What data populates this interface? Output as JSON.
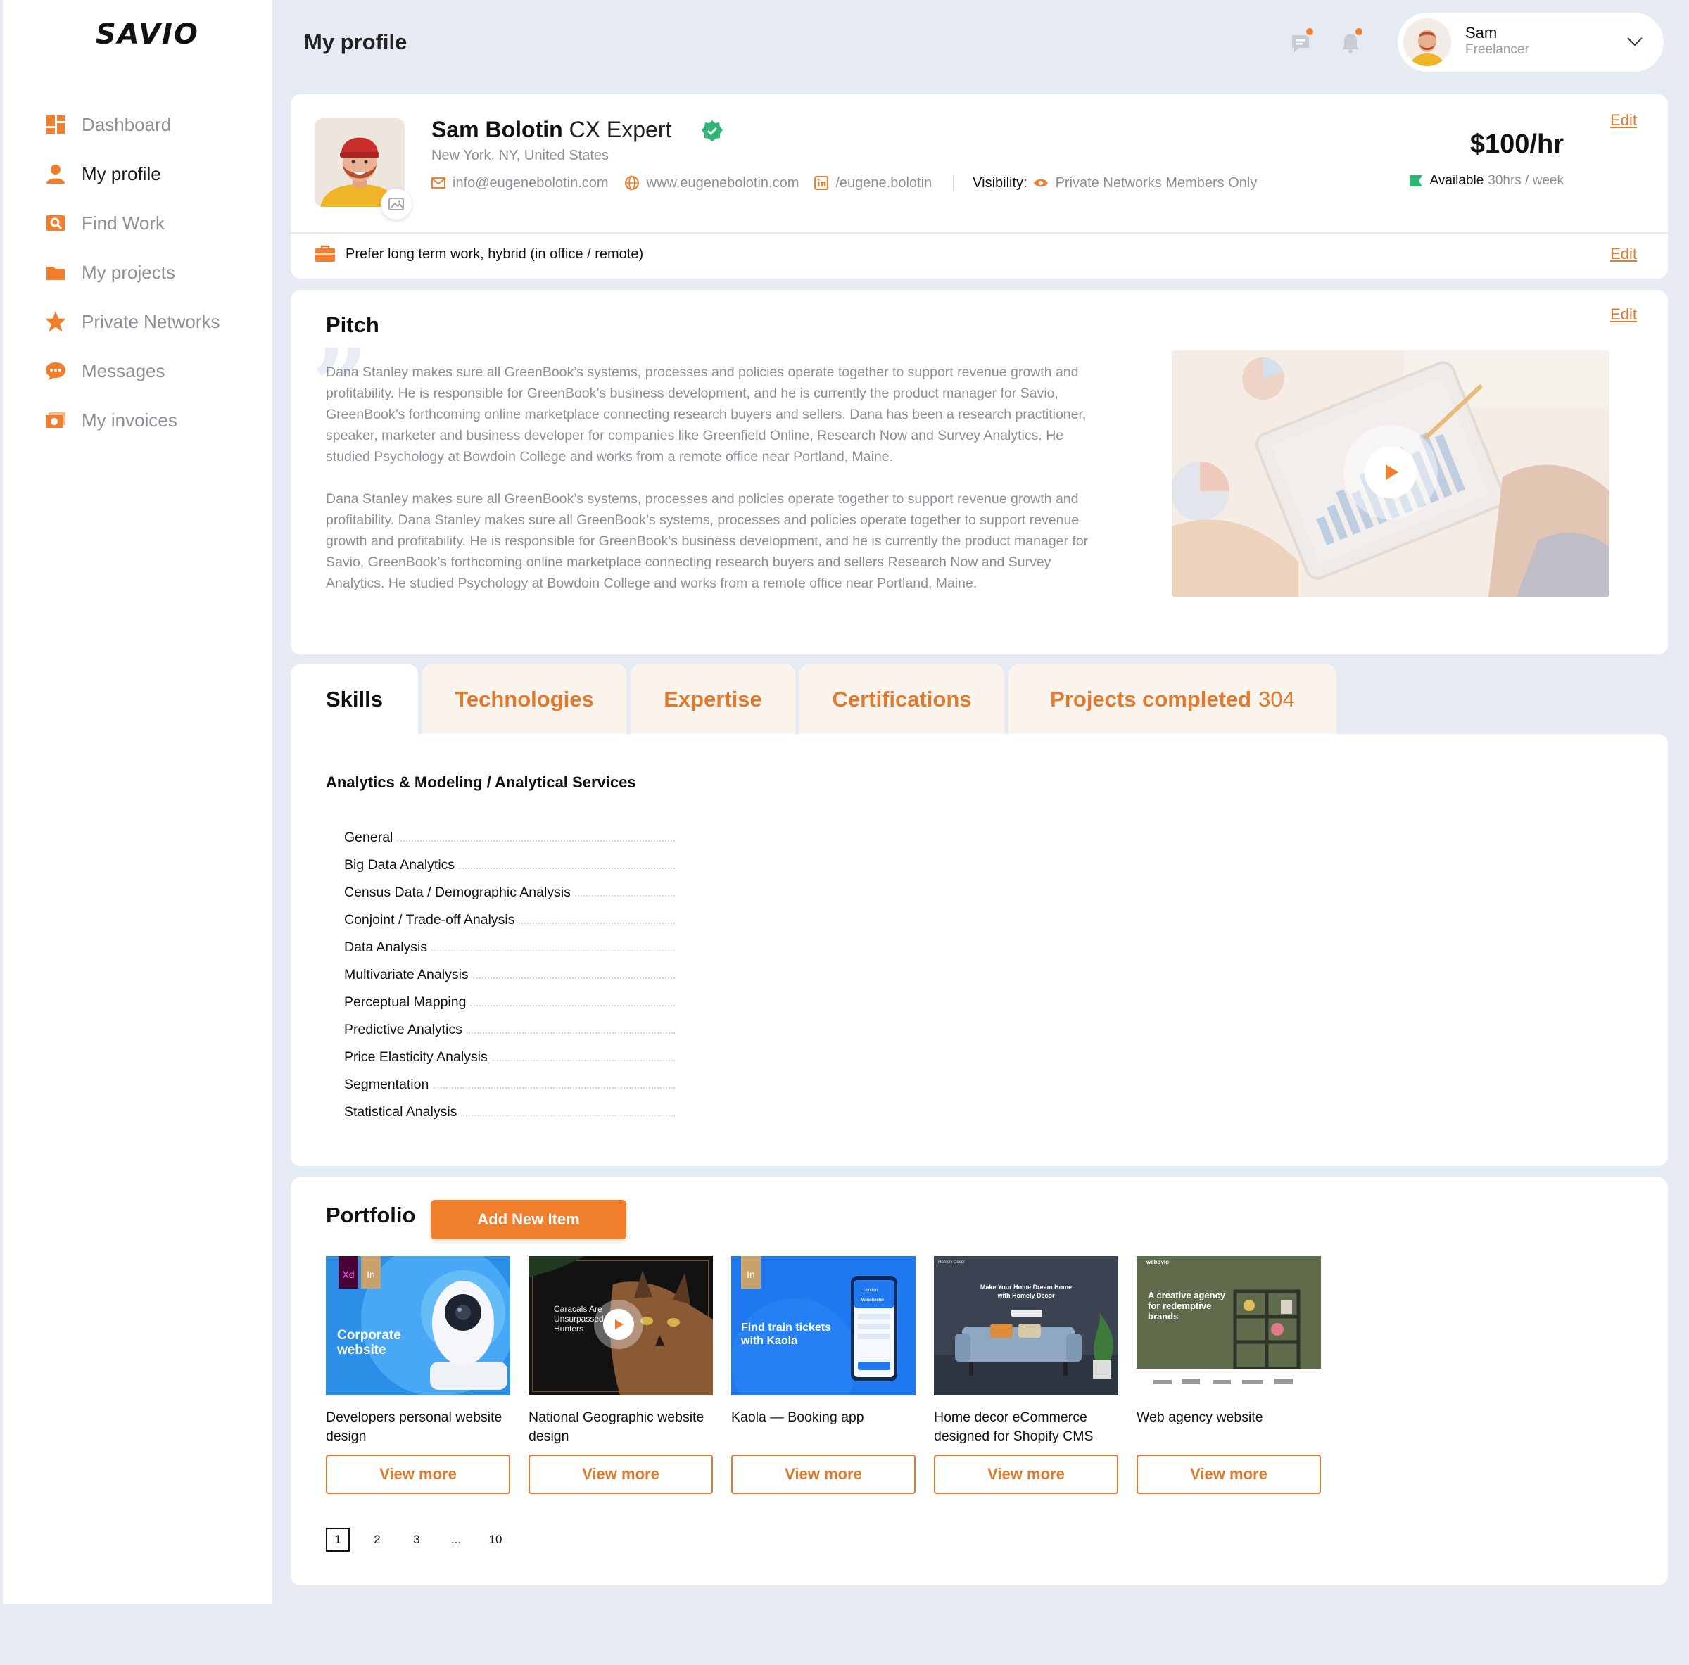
{
  "app": {
    "logo": "SAVIO",
    "page_title": "My profile"
  },
  "sidebar": {
    "items": [
      {
        "label": "Dashboard",
        "icon": "dashboard-icon"
      },
      {
        "label": "My profile",
        "icon": "user-icon",
        "active": true
      },
      {
        "label": "Find Work",
        "icon": "find-work-icon"
      },
      {
        "label": "My projects",
        "icon": "folder-icon"
      },
      {
        "label": "Private Networks",
        "icon": "star-icon"
      },
      {
        "label": "Messages",
        "icon": "chat-icon"
      },
      {
        "label": "My invoices",
        "icon": "invoice-icon"
      }
    ]
  },
  "header": {
    "user": {
      "name": "Sam",
      "role": "Freelancer"
    },
    "icons": [
      "messages-icon",
      "notifications-icon"
    ]
  },
  "profile": {
    "name": "Sam Bolotin",
    "title": "CX Expert",
    "location": "New York, NY, United States",
    "email": "info@eugenebolotin.com",
    "website": "www.eugenebolotin.com",
    "linkedin": "/eugene.bolotin",
    "visibility_label": "Visibility:",
    "visibility_value": "Private Networks Members Only",
    "rate": "$100/hr",
    "available_label": "Available",
    "available_hours": "30hrs / week",
    "edit_label": "Edit",
    "preference": "Prefer long term work, hybrid (in office / remote)"
  },
  "pitch": {
    "title": "Pitch",
    "edit_label": "Edit",
    "paragraphs": [
      "Dana Stanley makes sure all GreenBook’s systems, processes and policies operate together to support revenue growth and profitability. He is responsible for GreenBook’s business development, and he is currently the product manager for Savio, GreenBook’s forthcoming online marketplace connecting research buyers and sellers. Dana has been a research practitioner, speaker, marketer and business developer for companies like Greenfield Online, Research Now and Survey Analytics. He studied Psychology at Bowdoin College and works from a remote office near Portland, Maine.",
      "Dana Stanley makes sure all GreenBook’s systems, processes and policies operate together to support revenue growth and profitability. Dana Stanley makes sure all GreenBook’s systems, processes and policies operate together to support revenue growth and profitability.  He is responsible for GreenBook’s business development, and he is currently the product manager for Savio, GreenBook’s forthcoming online marketplace connecting research buyers and sellers Research Now and Survey Analytics. He studied Psychology at Bowdoin College and works from a remote office near Portland, Maine."
    ]
  },
  "tabs": [
    {
      "label": "Skills",
      "active": true
    },
    {
      "label": "Technologies"
    },
    {
      "label": "Expertise"
    },
    {
      "label": "Certifications"
    },
    {
      "label": "Projects completed",
      "count": "304"
    }
  ],
  "skills": {
    "group": "Analytics & Modeling / Analytical Services",
    "items": [
      "General",
      "Big Data Analytics",
      "Census Data / Demographic Analysis",
      "Conjoint / Trade-off  Analysis",
      "Data Analysis",
      "Multivariate Analysis",
      "Perceptual Mapping",
      "Predictive Analytics",
      "Price Elasticity Analysis",
      "Segmentation",
      "Statistical Analysis"
    ]
  },
  "portfolio": {
    "title": "Portfolio",
    "add_label": "Add New Item",
    "view_more": "View more",
    "items": [
      {
        "title": "Developers personal website design",
        "thumb_text": "Corporate website",
        "badges": [
          "Xd",
          "In"
        ]
      },
      {
        "title": "National Geographic website design",
        "thumb_text": "Caracals Are Unsurpassed Hunters"
      },
      {
        "title": "Kaola — Booking app",
        "thumb_text": "Find train tickets with Kaola",
        "badges": [
          "In"
        ],
        "app_from": "London",
        "app_to": "Manchester"
      },
      {
        "title": "Home decor eCommerce designed for Shopify CMS",
        "thumb_text": "Make Your Home Dream Home with Homely Decor",
        "brand": "Homely Decor"
      },
      {
        "title": "Web agency website",
        "thumb_text": "A creative agency for redemptive brands",
        "brand": "webovio"
      }
    ],
    "pagination": [
      "1",
      "2",
      "3",
      "...",
      "10"
    ]
  },
  "colors": {
    "accent": "#f07f2d",
    "verified": "#2bb673",
    "background": "#e6eaf3"
  }
}
